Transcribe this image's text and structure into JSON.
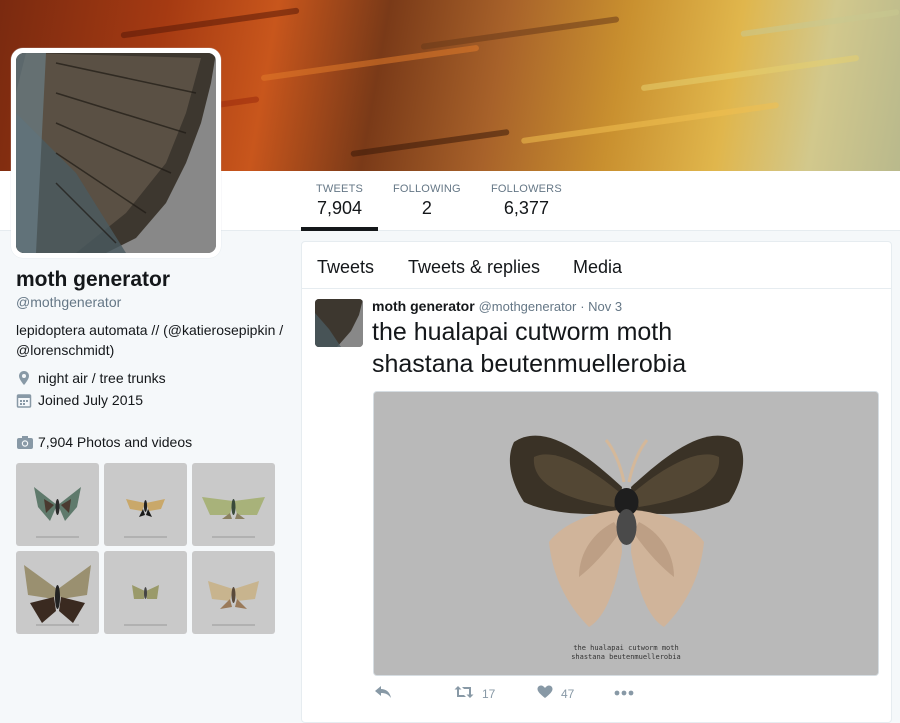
{
  "profile": {
    "name": "moth generator",
    "handle": "@mothgenerator",
    "bio": "lepidoptera automata // (@katierosepipkin / @lorenschmidt)",
    "location": "night air / tree trunks",
    "joined": "Joined July 2015",
    "photos_label": "7,904 Photos and videos"
  },
  "stats": [
    {
      "label": "TWEETS",
      "value": "7,904"
    },
    {
      "label": "FOLLOWING",
      "value": "2"
    },
    {
      "label": "FOLLOWERS",
      "value": "6,377"
    }
  ],
  "tabs": [
    "Tweets",
    "Tweets & replies",
    "Media"
  ],
  "tweet": {
    "name": "moth generator",
    "handle": "@mothgenerator",
    "date": "· Nov 3",
    "line1": "the hualapai cutworm moth",
    "line2": "shastana beutenmuellerobia",
    "media_caption_1": "the hualapai cutworm moth",
    "media_caption_2": "shastana beutenmuellerobia",
    "retweets": "17",
    "likes": "47"
  },
  "colors": {
    "background": "#f5f8fa",
    "text": "#14171a",
    "muted": "#657786",
    "icon": "#8899a6",
    "border": "#e6ecf0"
  },
  "icons": [
    "location-icon",
    "calendar-icon",
    "camera-icon",
    "reply-icon",
    "retweet-icon",
    "heart-icon",
    "more-icon"
  ]
}
